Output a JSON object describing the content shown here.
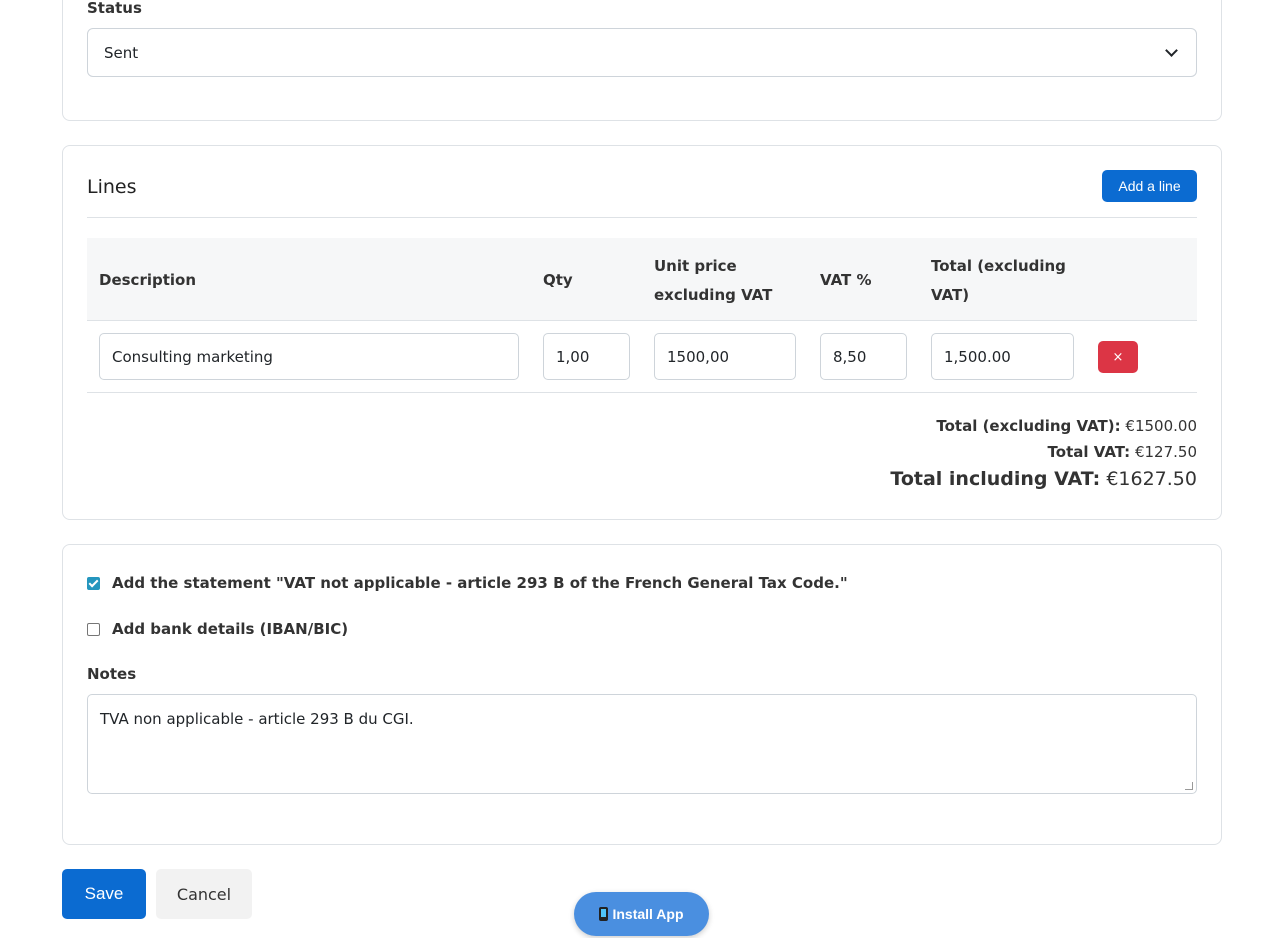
{
  "status": {
    "label": "Status",
    "selected": "Sent"
  },
  "lines": {
    "title": "Lines",
    "add_label": "Add a line",
    "columns": {
      "description": "Description",
      "qty": "Qty",
      "unit_price_1": "Unit price",
      "unit_price_2": "excluding VAT",
      "vat": "VAT %",
      "total_1": "Total (excluding",
      "total_2": "VAT)"
    },
    "rows": [
      {
        "description": "Consulting marketing",
        "qty": "1,00",
        "unit_price": "1500,00",
        "vat": "8,50",
        "total": "1,500.00",
        "delete_label": "×"
      }
    ],
    "totals": {
      "excl_label": "Total (excluding VAT):",
      "excl_value": "€1500.00",
      "vat_label": "Total VAT:",
      "vat_value": "€127.50",
      "incl_label": "Total including VAT:",
      "incl_value": "€1627.50"
    }
  },
  "options": {
    "vat_statement_label": "Add the statement \"VAT not applicable - article 293 B of the French General Tax Code.\"",
    "vat_statement_checked": true,
    "bank_details_label": "Add bank details (IBAN/BIC)",
    "bank_details_checked": false,
    "notes_label": "Notes",
    "notes_value": "TVA non applicable - article 293 B du CGI."
  },
  "actions": {
    "save_label": "Save",
    "cancel_label": "Cancel",
    "install_label": "Install App"
  },
  "colors": {
    "primary": "#0b6bd1",
    "danger": "#dc3545",
    "checkbox": "#2596be",
    "install": "#4a8fe0"
  }
}
